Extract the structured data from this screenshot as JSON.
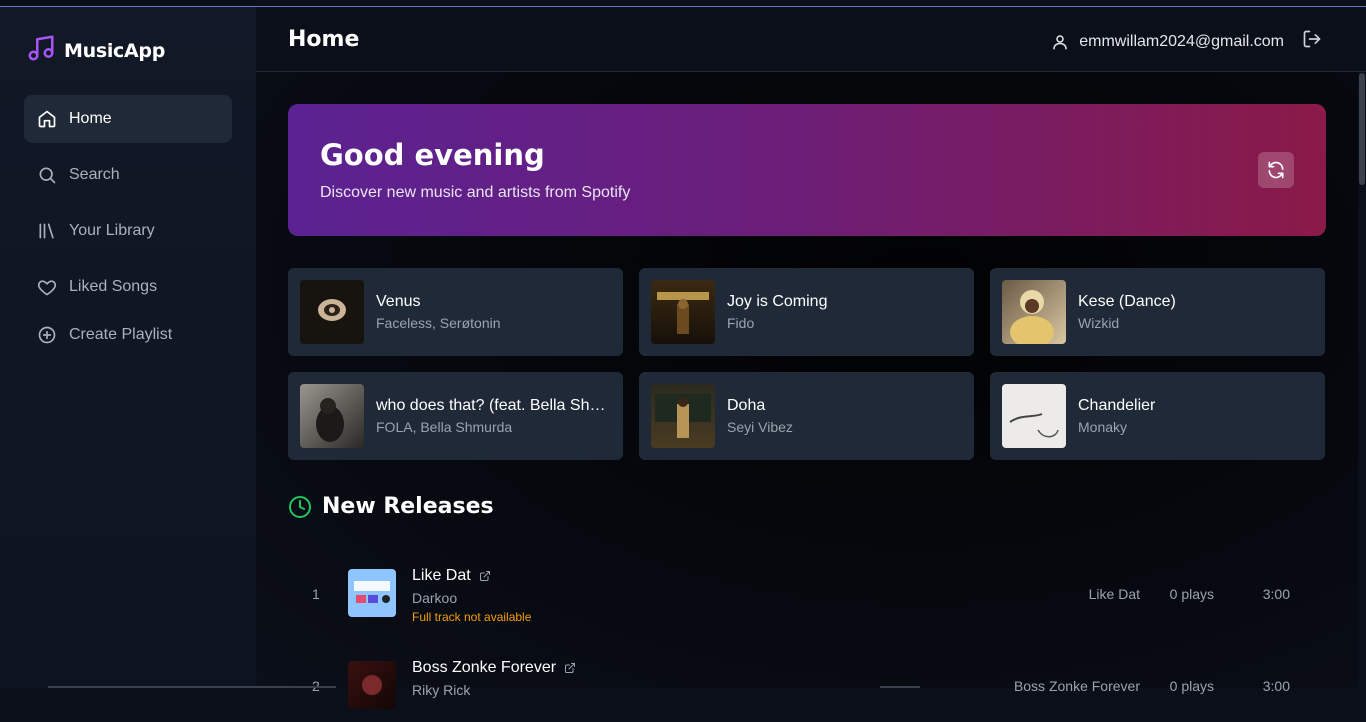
{
  "app": {
    "name": "MusicApp"
  },
  "sidebar": {
    "items": [
      {
        "label": "Home",
        "icon": "home-icon"
      },
      {
        "label": "Search",
        "icon": "search-icon"
      },
      {
        "label": "Your Library",
        "icon": "library-icon"
      },
      {
        "label": "Liked Songs",
        "icon": "heart-icon"
      },
      {
        "label": "Create Playlist",
        "icon": "plus-circle-icon"
      }
    ]
  },
  "header": {
    "title": "Home",
    "user_email": "emmwillam2024@gmail.com"
  },
  "hero": {
    "title": "Good evening",
    "subtitle": "Discover new music and artists from Spotify"
  },
  "recent": [
    {
      "title": "Venus",
      "artists": "Faceless, Serøtonin"
    },
    {
      "title": "Joy is Coming",
      "artists": "Fido"
    },
    {
      "title": "Kese (Dance)",
      "artists": "Wizkid"
    },
    {
      "title": "who does that? (feat. Bella Shm...",
      "artists": "FOLA, Bella Shmurda"
    },
    {
      "title": "Doha",
      "artists": "Seyi Vibez"
    },
    {
      "title": "Chandelier",
      "artists": "Monaky"
    }
  ],
  "new_releases": {
    "title": "New Releases",
    "tracks": [
      {
        "num": "1",
        "title": "Like Dat",
        "artist": "Darkoo",
        "note": "Full track not available",
        "album": "Like Dat",
        "plays": "0 plays",
        "duration": "3:00"
      },
      {
        "num": "2",
        "title": "Boss Zonke Forever",
        "artist": "Riky Rick",
        "album": "Boss Zonke Forever",
        "plays": "0 plays",
        "duration": "3:00"
      }
    ]
  },
  "colors": {
    "accent": "#a855f7",
    "clock": "#22c55e",
    "warning": "#f59e0b"
  }
}
